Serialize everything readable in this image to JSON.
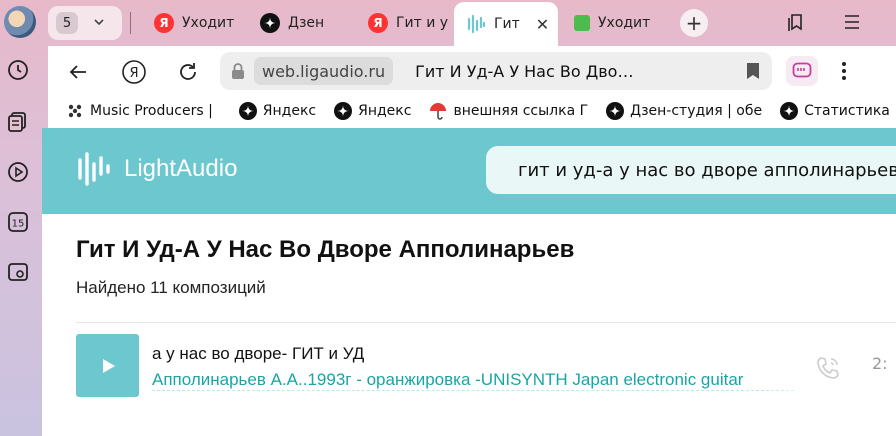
{
  "tabs": {
    "count": "5",
    "items": [
      {
        "label": "Уходит",
        "icon": "yandex-icon",
        "active": false
      },
      {
        "label": "Дзен",
        "icon": "dzen-icon",
        "active": false
      },
      {
        "label": "Гит и у",
        "icon": "yandex-icon",
        "active": false
      },
      {
        "label": "Гит",
        "icon": "lightaudio-icon",
        "active": true
      },
      {
        "label": "Уходит",
        "icon": "green-square-icon",
        "active": false
      }
    ],
    "close_label": "✕",
    "new_tab_label": "+"
  },
  "address_bar": {
    "domain": "web.ligaudio.ru",
    "page_title": "Гит И Уд-А У Нас Во Дво…"
  },
  "bookmarks": [
    {
      "label": "Music Producers |",
      "icon": "dots-icon"
    },
    {
      "label": "Яндекс",
      "icon": "dzen-icon"
    },
    {
      "label": "Яндекс",
      "icon": "dzen-icon"
    },
    {
      "label": "внешняя ссылка Г",
      "icon": "umbrella-icon"
    },
    {
      "label": "Дзен-студия | обе",
      "icon": "dzen-icon"
    },
    {
      "label": "Статистика",
      "icon": "dzen-icon"
    }
  ],
  "site": {
    "logo_text": "LightAudio",
    "search_value": "гит и уд-а у нас во дворе апполинарьев",
    "heading": "Гит И Уд-А У Нас Во Дворе Апполинарьев",
    "found_text": "Найдено 11 композиций",
    "tracks": [
      {
        "title": "а у нас во дворе- ГИТ и УД",
        "artist": "Апполинарьев А.А..1993г - оранжировка -UNISYNTH Japan electronic guitar",
        "duration": "2:"
      }
    ]
  },
  "colors": {
    "accent": "#6cc7ce",
    "link": "#1aa5a5"
  }
}
